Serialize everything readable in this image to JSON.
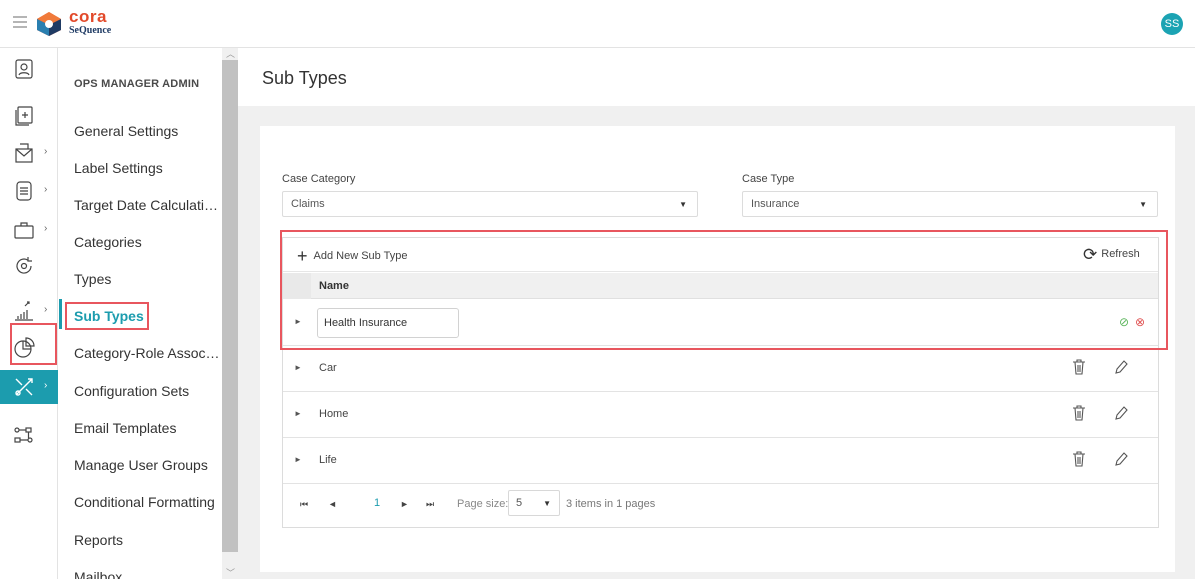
{
  "app": {
    "logo_text": "cora",
    "logo_subtext": "SeQuence",
    "user_initials": "SS"
  },
  "rail": {
    "items": [
      {
        "icon": "user-profile-icon",
        "has_chevron": false
      },
      {
        "icon": "add-document-icon",
        "has_chevron": false
      },
      {
        "icon": "inbox-tray-icon",
        "has_chevron": true
      },
      {
        "icon": "document-list-icon",
        "has_chevron": true
      },
      {
        "icon": "briefcase-icon",
        "has_chevron": true
      },
      {
        "icon": "sync-cycle-icon",
        "has_chevron": false
      },
      {
        "icon": "bar-chart-icon",
        "has_chevron": true
      },
      {
        "icon": "pie-chart-icon",
        "has_chevron": false
      },
      {
        "icon": "tools-icon",
        "has_chevron": true,
        "active": true
      },
      {
        "icon": "workflow-icon",
        "has_chevron": false
      }
    ]
  },
  "sidebar": {
    "title": "OPS MANAGER ADMIN",
    "items": [
      {
        "label": "General Settings"
      },
      {
        "label": "Label Settings"
      },
      {
        "label": "Target Date Calculatio..."
      },
      {
        "label": "Categories"
      },
      {
        "label": "Types"
      },
      {
        "label": "Sub Types",
        "active": true
      },
      {
        "label": "Category-Role Associa..."
      },
      {
        "label": "Configuration Sets"
      },
      {
        "label": "Email Templates"
      },
      {
        "label": "Manage User Groups"
      },
      {
        "label": "Conditional Formatting"
      },
      {
        "label": "Reports"
      },
      {
        "label": "Mailbox"
      }
    ]
  },
  "page": {
    "title": "Sub Types"
  },
  "filters": {
    "case_category_label": "Case Category",
    "case_category_value": "Claims",
    "case_type_label": "Case Type",
    "case_type_value": "Insurance"
  },
  "grid": {
    "add_label": "Add New Sub Type",
    "refresh_label": "Refresh",
    "column_name": "Name",
    "editing_value": "Health Insurance",
    "rows": [
      {
        "name": "Car"
      },
      {
        "name": "Home"
      },
      {
        "name": "Life"
      }
    ],
    "pager": {
      "current_page": "1",
      "page_size_label": "Page size:",
      "page_size_value": "5",
      "info": "3 items in 1 pages"
    }
  },
  "colors": {
    "accent": "#1c9cae",
    "highlight_outline": "#e8565e",
    "ok": "#5bb55b",
    "cancel": "#e05252",
    "logo_red": "#e24a2b"
  }
}
